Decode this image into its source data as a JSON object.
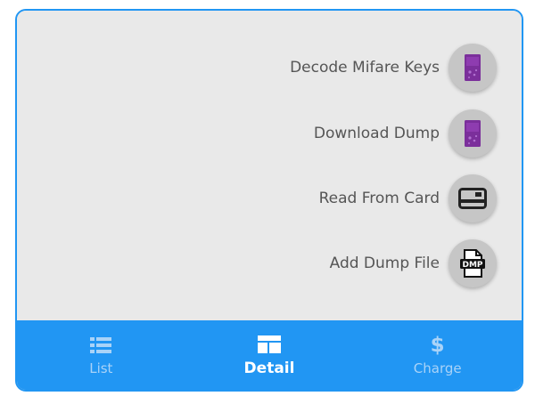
{
  "actions": [
    {
      "label": "Decode Mifare Keys",
      "icon": "purple-card-icon"
    },
    {
      "label": "Download Dump",
      "icon": "purple-card-icon"
    },
    {
      "label": "Read From Card",
      "icon": "card-reader-icon"
    },
    {
      "label": "Add Dump File",
      "icon": "dmp-file-icon"
    }
  ],
  "dmp_icon_text": "DMP",
  "nav": {
    "items": [
      {
        "label": "List",
        "icon": "list-icon",
        "active": false
      },
      {
        "label": "Detail",
        "icon": "detail-icon",
        "active": true
      },
      {
        "label": "Charge",
        "icon": "dollar-icon",
        "glyph": "$",
        "active": false
      }
    ]
  },
  "colors": {
    "accent": "#2196f3",
    "background": "#e9e9e9",
    "fab": "#c6c6c6",
    "card_purple": "#7b2f9b"
  }
}
